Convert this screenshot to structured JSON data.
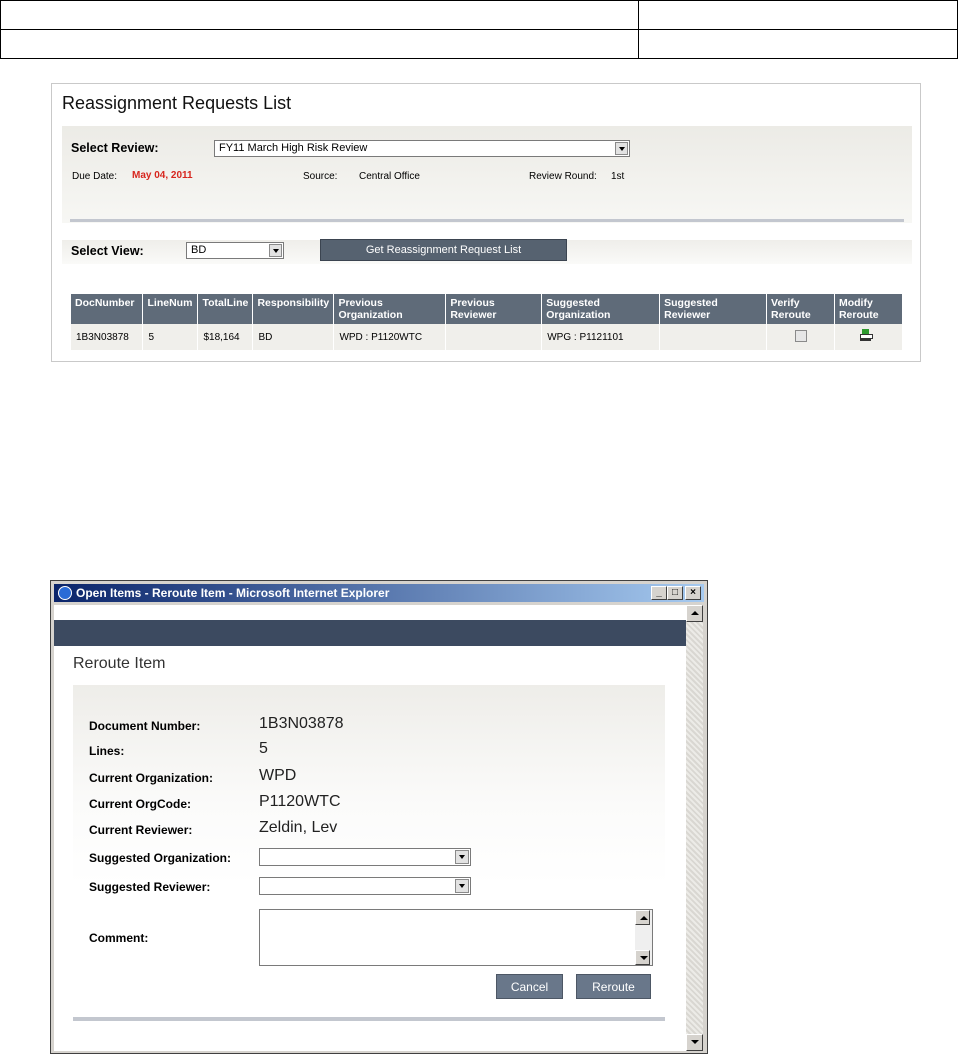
{
  "panel": {
    "title": "Reassignment Requests List",
    "select_review_label": "Select Review:",
    "select_review_value": "FY11 March High Risk Review",
    "due_date_label": "Due Date:",
    "due_date_value": "May 04, 2011",
    "source_label": "Source:",
    "source_value": "Central Office",
    "review_round_label": "Review Round:",
    "review_round_value": "1st",
    "select_view_label": "Select View:",
    "select_view_value": "BD",
    "get_list_button": "Get Reassignment Request List",
    "columns": [
      "DocNumber",
      "LineNum",
      "TotalLine",
      "Responsibility",
      "Previous Organization",
      "Previous Reviewer",
      "Suggested Organization",
      "Suggested Reviewer",
      "Verify Reroute",
      "Modify Reroute"
    ],
    "rows": [
      {
        "doc": "1B3N03878",
        "line": "5",
        "total": "$18,164",
        "resp": "BD",
        "prev_org": "WPD : P1120WTC",
        "prev_rev": "",
        "sugg_org": "WPG : P1121101",
        "sugg_rev": ""
      }
    ]
  },
  "popup": {
    "window_title": "Open Items - Reroute Item - Microsoft Internet Explorer",
    "title": "Reroute Item",
    "fields": {
      "doc_number_label": "Document Number:",
      "doc_number_value": "1B3N03878",
      "lines_label": "Lines:",
      "lines_value": "5",
      "current_org_label": "Current Organization:",
      "current_org_value": "WPD",
      "current_orgcode_label": "Current OrgCode:",
      "current_orgcode_value": "P1120WTC",
      "current_reviewer_label": "Current Reviewer:",
      "current_reviewer_value": "Zeldin, Lev",
      "suggested_org_label": "Suggested Organization:",
      "suggested_reviewer_label": "Suggested Reviewer:",
      "comment_label": "Comment:"
    },
    "cancel_button": "Cancel",
    "reroute_button": "Reroute"
  },
  "colors": {
    "due_date": "#d7261e",
    "header_band": "#3c4a60",
    "grid_header": "#5f6b79"
  }
}
